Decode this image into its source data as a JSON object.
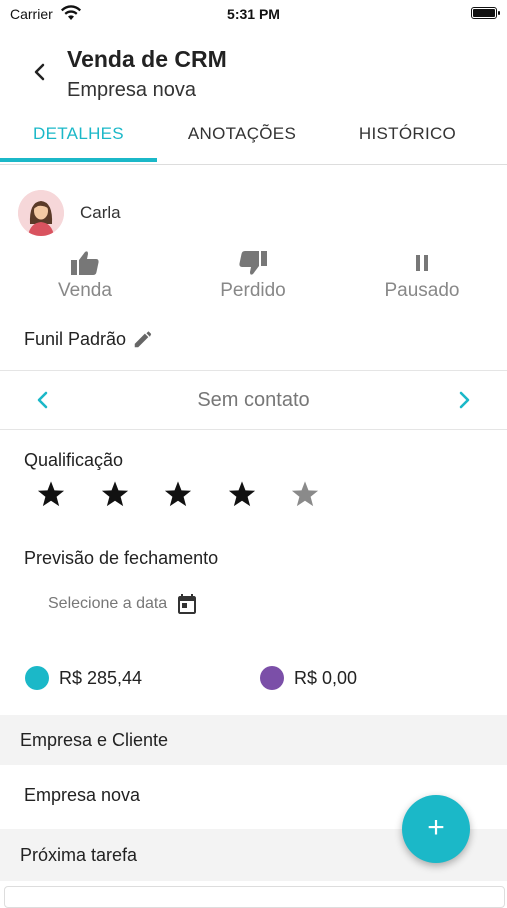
{
  "status_bar": {
    "carrier": "Carrier",
    "time": "5:31 PM"
  },
  "header": {
    "title": "Venda de CRM",
    "subtitle": "Empresa nova"
  },
  "tabs": [
    {
      "label": "DETALHES",
      "active": true
    },
    {
      "label": "ANOTAÇÕES",
      "active": false
    },
    {
      "label": "HISTÓRICO",
      "active": false
    }
  ],
  "owner": {
    "name": "Carla"
  },
  "status_actions": [
    {
      "label": "Venda",
      "icon": "thumbs-up-icon"
    },
    {
      "label": "Perdido",
      "icon": "thumbs-down-icon"
    },
    {
      "label": "Pausado",
      "icon": "pause-icon"
    }
  ],
  "funnel": {
    "label": "Funil Padrão"
  },
  "stage": {
    "label": "Sem contato"
  },
  "qualification": {
    "label": "Qualificação",
    "rating": 4,
    "max": 5
  },
  "forecast": {
    "label": "Previsão de fechamento",
    "placeholder": "Selecione a data"
  },
  "values": [
    {
      "amount": "R$ 285,44",
      "color": "#1bb8c8"
    },
    {
      "amount": "R$ 0,00",
      "color": "#7b4fa8"
    }
  ],
  "sections": {
    "company_client": {
      "header": "Empresa e Cliente",
      "value": "Empresa nova"
    },
    "next_task": {
      "header": "Próxima tarefa"
    }
  },
  "fab": {
    "label": "+"
  },
  "colors": {
    "accent": "#1bb8c8",
    "purple": "#7b4fa8"
  }
}
